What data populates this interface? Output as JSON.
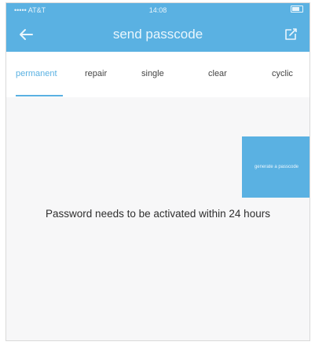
{
  "colors": {
    "accent": "#5ab1e2",
    "background": "#f7f7f8",
    "text": "#2e2e2e"
  },
  "status_bar": {
    "carrier": "••••• AT&T",
    "time": "14:08",
    "battery_text": "◀ ⦁"
  },
  "header": {
    "title": "send passcode",
    "back_icon": "arrow-left-icon",
    "edit_icon": "edit-square-icon"
  },
  "tabs": [
    {
      "label": "permanent",
      "active": true
    },
    {
      "label": "repair",
      "active": false
    },
    {
      "label": "single",
      "active": false
    },
    {
      "label": "clear",
      "active": false
    },
    {
      "label": "cyclic",
      "active": false
    }
  ],
  "main": {
    "generate_button_label": "generate a passcode",
    "notice": "Password needs to be activated within 24 hours"
  }
}
